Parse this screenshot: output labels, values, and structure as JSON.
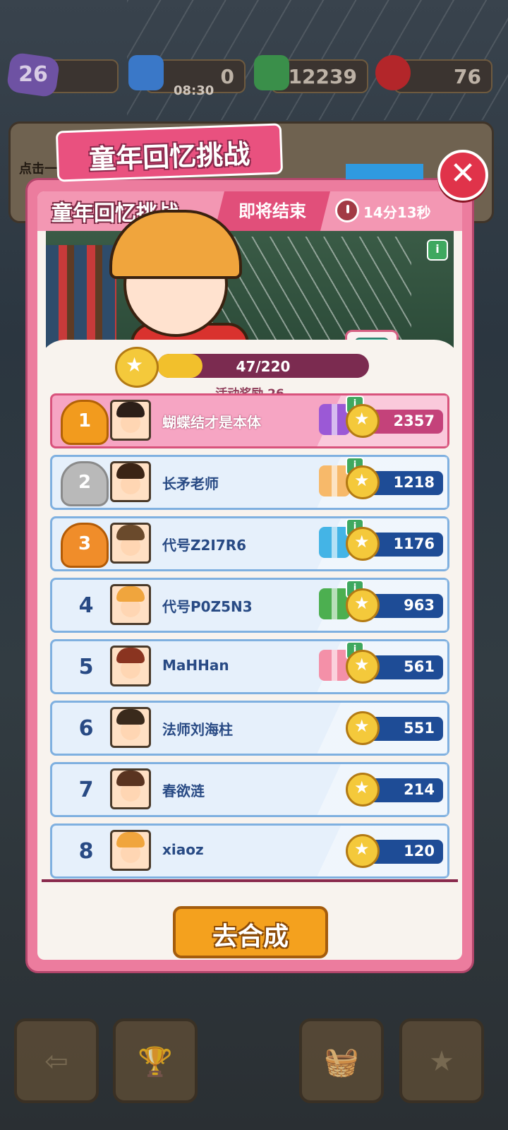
{
  "top": {
    "level": "26",
    "energy": "0",
    "energy_timer": "08:30",
    "cash": "12239",
    "gems": "76"
  },
  "back_card_text": "点击一",
  "event": {
    "tag_title": "童年回忆挑战",
    "header_title": "童年回忆挑战",
    "ending_label": "即将结束",
    "timer": "14分13秒",
    "info_label": "i",
    "gift_multiplier": "x1",
    "progress_text": "47/220",
    "progress_fraction": 0.2136,
    "reward_label": "活动奖励 26"
  },
  "leaderboard": [
    {
      "rank": "1",
      "name": "蝴蝶结才是本体",
      "score": "2357",
      "gift": true,
      "gift_color": "#9b59d6",
      "hair": "#2c1f18"
    },
    {
      "rank": "2",
      "name": "长矛老师",
      "score": "1218",
      "gift": true,
      "gift_color": "#f7b96a",
      "hair": "#3b2415"
    },
    {
      "rank": "3",
      "name": "代号Z2I7R6",
      "score": "1176",
      "gift": true,
      "gift_color": "#44b4e6",
      "hair": "#6a4a2c"
    },
    {
      "rank": "4",
      "name": "代号P0Z5N3",
      "score": "963",
      "gift": true,
      "gift_color": "#4caf50",
      "hair": "#f0a53d"
    },
    {
      "rank": "5",
      "name": "MaHHan",
      "score": "561",
      "gift": true,
      "gift_color": "#f490a8",
      "hair": "#8a3420"
    },
    {
      "rank": "6",
      "name": "法师刘海柱",
      "score": "551",
      "gift": false,
      "gift_color": "",
      "hair": "#3a2a1c"
    },
    {
      "rank": "7",
      "name": "春欲涟",
      "score": "214",
      "gift": false,
      "gift_color": "",
      "hair": "#5a3420"
    },
    {
      "rank": "8",
      "name": "xiaoz",
      "score": "120",
      "gift": false,
      "gift_color": "",
      "hair": "#f0a53d"
    }
  ],
  "go_button_label": "去合成",
  "close_label": "✕",
  "nav": {
    "back_icon": "⇦",
    "trophy_icon": "🏆",
    "basket_icon": "🧺",
    "album_icon": "★"
  },
  "colors": {
    "accent_pink": "#e9517f",
    "button_orange": "#f4a11e",
    "rank_blue": "#284a84"
  }
}
